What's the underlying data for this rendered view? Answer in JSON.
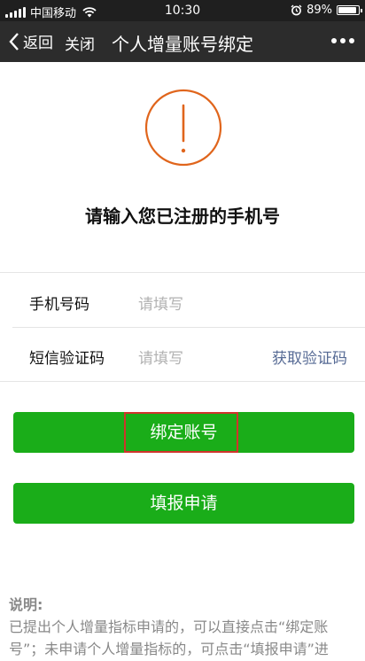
{
  "status_bar": {
    "carrier": "中国移动",
    "time": "10:30",
    "battery_text": "89%",
    "battery_level": 0.89,
    "icons": [
      "signal-icon",
      "wifi-icon",
      "alarm-icon",
      "battery-icon"
    ]
  },
  "nav": {
    "back_label": "返回",
    "close_label": "关闭",
    "title": "个人增量账号绑定",
    "more_icon": "more-dots-icon"
  },
  "colors": {
    "nav_bg": "#2c2c2c",
    "warning": "#e0651c",
    "primary": "#1aad19",
    "link": "#576b95",
    "highlight": "#d0342c"
  },
  "prompt": "请输入您已注册的手机号",
  "form": {
    "phone_label": "手机号码",
    "phone_placeholder": "请填写",
    "phone_value": "",
    "code_label": "短信验证码",
    "code_placeholder": "请填写",
    "code_value": "",
    "get_code_label": "获取验证码"
  },
  "buttons": {
    "bind_label": "绑定账号",
    "apply_label": "填报申请"
  },
  "note": {
    "heading": "说明:",
    "text": "已提出个人增量指标申请的，可以直接点击“绑定账号”；未申请个人增量指标的，可点击“填报申请”进"
  }
}
